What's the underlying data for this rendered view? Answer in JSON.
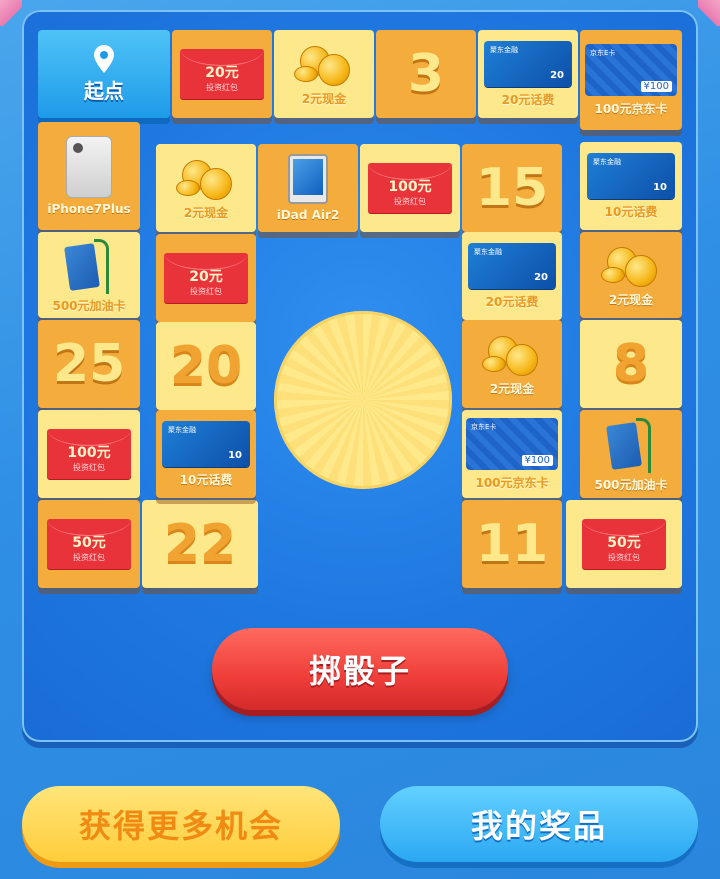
{
  "board": {
    "start_label": "起点",
    "tiles": [
      {
        "id": "t1",
        "kind": "envelope",
        "amount": "20元",
        "sub": "投资红包"
      },
      {
        "id": "t2",
        "kind": "coins",
        "label": "2元现金"
      },
      {
        "id": "t3",
        "kind": "number",
        "value": "3"
      },
      {
        "id": "t4",
        "kind": "bank",
        "brand": "聚东金融",
        "amount": "20",
        "label": "20元话费"
      },
      {
        "id": "t5",
        "kind": "jd",
        "brand": "京东E卡",
        "amount": "¥100",
        "label": "100元京东卡"
      },
      {
        "id": "t6",
        "kind": "jd-none",
        "label": ""
      },
      {
        "id": "t7",
        "kind": "phone",
        "label": "iPhone7Plus"
      },
      {
        "id": "t8",
        "kind": "coins",
        "label": "2元现金"
      },
      {
        "id": "t9",
        "kind": "tablet",
        "label": "iDad Air2"
      },
      {
        "id": "t10",
        "kind": "envelope",
        "amount": "100元",
        "sub": "投资红包"
      },
      {
        "id": "t11",
        "kind": "number",
        "value": "15"
      },
      {
        "id": "t12",
        "kind": "bank",
        "brand": "聚东金融",
        "amount": "10",
        "label": "10元话费"
      },
      {
        "id": "t13",
        "kind": "fuel",
        "label": "500元加油卡"
      },
      {
        "id": "t14",
        "kind": "envelope",
        "amount": "20元",
        "sub": "投资红包"
      },
      {
        "id": "t15",
        "kind": "bank",
        "brand": "聚东金融",
        "amount": "20",
        "label": "20元话费"
      },
      {
        "id": "t16",
        "kind": "coins",
        "label": "2元现金"
      },
      {
        "id": "t17",
        "kind": "number",
        "value": "25"
      },
      {
        "id": "t18",
        "kind": "number",
        "value": "20"
      },
      {
        "id": "t19",
        "kind": "coins",
        "label": "2元现金"
      },
      {
        "id": "t20",
        "kind": "number",
        "value": "8"
      },
      {
        "id": "t21",
        "kind": "envelope",
        "amount": "100元",
        "sub": "投资红包"
      },
      {
        "id": "t22",
        "kind": "bank",
        "brand": "聚东金融",
        "amount": "10",
        "label": "10元话费"
      },
      {
        "id": "t23",
        "kind": "jd",
        "brand": "京东E卡",
        "amount": "¥100",
        "label": "100元京东卡"
      },
      {
        "id": "t24",
        "kind": "fuel",
        "label": "500元加油卡"
      },
      {
        "id": "t25",
        "kind": "envelope",
        "amount": "50元",
        "sub": "投资红包"
      },
      {
        "id": "t26",
        "kind": "number",
        "value": "22"
      },
      {
        "id": "t27",
        "kind": "number",
        "value": "11"
      },
      {
        "id": "t28",
        "kind": "envelope",
        "amount": "50元",
        "sub": "投资红包"
      }
    ]
  },
  "actions": {
    "roll_dice": "掷骰子",
    "more_chances": "获得更多机会",
    "my_prizes": "我的奖品"
  },
  "colors": {
    "board_blue": "#1f78e0",
    "tile_yellow": "#fde98c",
    "tile_orange": "#f4ad3d",
    "envelope_red": "#e8333a",
    "roll_red": "#ef3e3a"
  }
}
